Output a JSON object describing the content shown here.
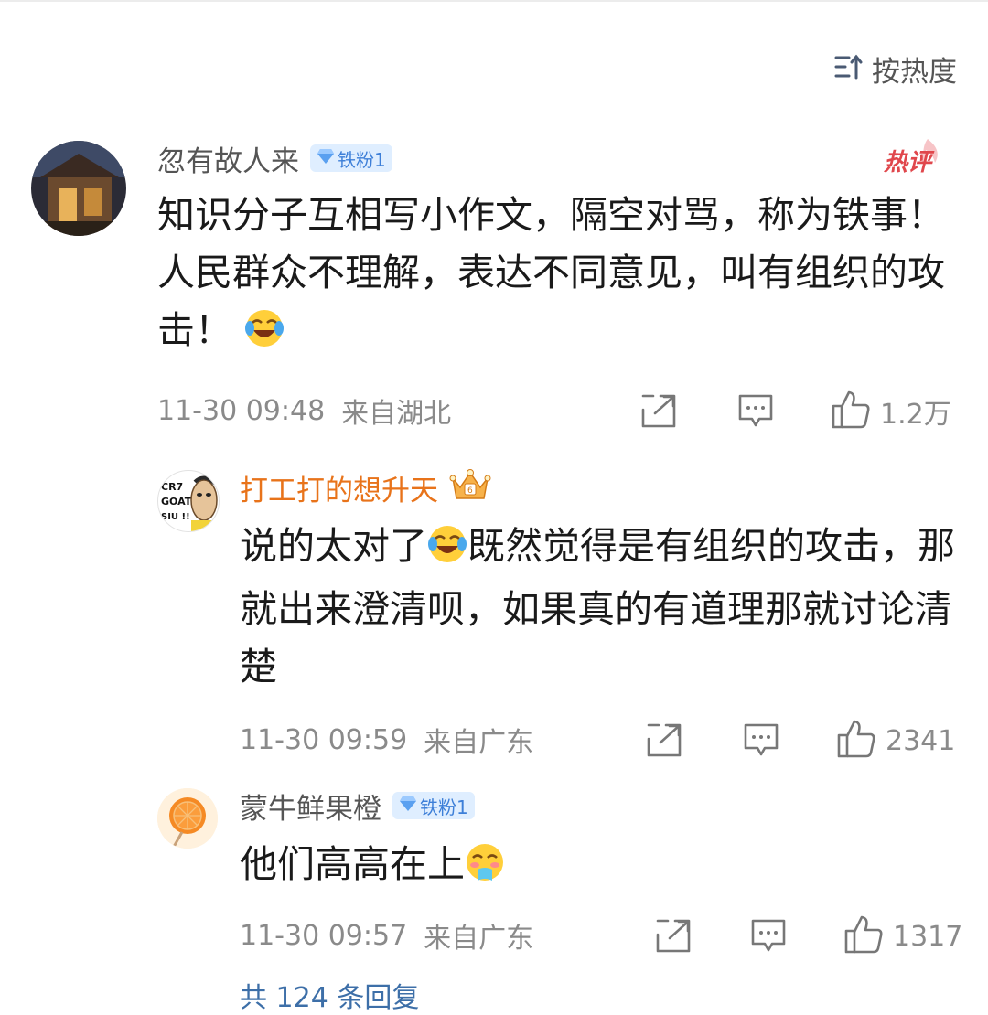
{
  "sort": {
    "label": "按热度",
    "icon": "sort-descending-icon"
  },
  "comments": [
    {
      "username": "忽有故人来",
      "badge": "铁粉1",
      "hot_tag": "热评",
      "content": "知识分子互相写小作文，隔空对骂，称为铁事！人民群众不理解，表达不同意见，叫有组织的攻击！",
      "emoji": "laugh-cry-emoji",
      "time": "11-30 09:48",
      "location": "来自湖北",
      "likes": "1.2万"
    },
    {
      "username": "打工打的想升天",
      "avatar_text": [
        "CR7",
        "GOAT",
        "SIU !!"
      ],
      "badge_icon": "crown-icon",
      "content_before": "说的太对了",
      "content_after": "既然觉得是有组织的攻击，那就出来澄清呗，如果真的有道理那就讨论清楚",
      "emoji": "laugh-cry-emoji",
      "time": "11-30 09:59",
      "location": "来自广东",
      "likes": "2341"
    },
    {
      "username": "蒙牛鲜果橙",
      "badge": "铁粉1",
      "content": "他们高高在上",
      "emoji": "steam-nose-emoji",
      "time": "11-30 09:57",
      "location": "来自广东",
      "likes": "1317"
    }
  ],
  "bottom_partial": "共 124 条回复",
  "colors": {
    "accent_blue": "#3d7fd8",
    "vip_orange": "#e8731a",
    "hot_red": "#e0474c",
    "meta_gray": "#8a8a8a"
  }
}
